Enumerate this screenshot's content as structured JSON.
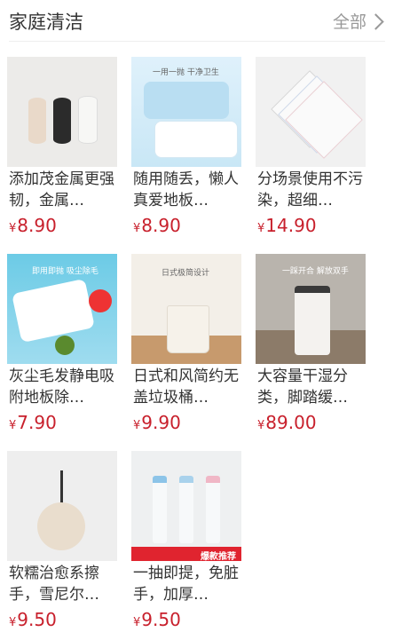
{
  "header": {
    "title": "家庭清洁",
    "all_label": "全部"
  },
  "products": [
    {
      "name": "添加茂金属更强韧，金属…",
      "currency": "¥",
      "price": "8.90"
    },
    {
      "name": "随用随丢，懒人真爱地板…",
      "currency": "¥",
      "price": "8.90"
    },
    {
      "name": "分场景使用不污染，超细…",
      "currency": "¥",
      "price": "14.90"
    },
    {
      "name": "灰尘毛发静电吸附地板除…",
      "currency": "¥",
      "price": "7.90"
    },
    {
      "name": "日式和风简约无盖垃圾桶…",
      "currency": "¥",
      "price": "9.90"
    },
    {
      "name": "大容量干湿分类，脚踏缓…",
      "currency": "¥",
      "price": "89.00"
    },
    {
      "name": "软糯治愈系擦手，雪尼尔…",
      "currency": "¥",
      "price": "9.50"
    },
    {
      "name": "一抽即提，免脏手，加厚…",
      "currency": "¥",
      "price": "9.50"
    }
  ],
  "thumb_text": {
    "p2_banner": "一用一抛 干净卫生",
    "p4_banner": "即用即抛 吸尘除毛",
    "p5_banner": "日式极简设计",
    "p6_banner": "一踩开合 解放双手",
    "p8_banner": "爆款推荐"
  },
  "colors": {
    "price": "#c8202c",
    "title": "#333333",
    "muted": "#999999"
  }
}
